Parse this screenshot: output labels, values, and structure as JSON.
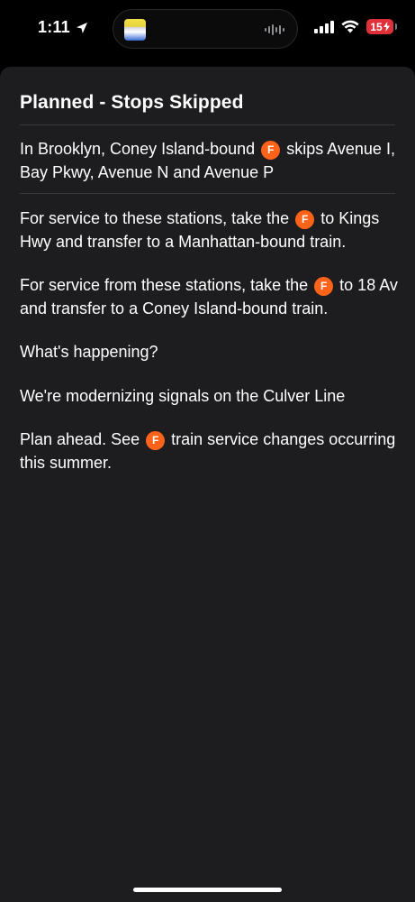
{
  "status_bar": {
    "time": "1:11",
    "battery": "15"
  },
  "alert": {
    "title": "Planned - Stops Skipped",
    "route_badge": "F",
    "summary": {
      "before": "In Brooklyn, Coney Island-bound",
      "after": "skips Avenue I, Bay Pkwy, Avenue N and Avenue P"
    },
    "to_service": {
      "before": "For service to these stations, take the",
      "after": "to Kings Hwy and transfer to a Manhattan-bound train."
    },
    "from_service": {
      "before": "For service from these stations, take the",
      "after": "to 18 Av and transfer to a Coney Island-bound train."
    },
    "whats_happening": "What's happening?",
    "reason": "We're modernizing signals on the Culver Line",
    "plan_ahead": {
      "before": "Plan ahead. See",
      "after": "train service changes occurring this summer."
    }
  },
  "colors": {
    "route_f": "#ff6319",
    "sheet_bg": "#1d1d1f",
    "battery_low": "#e0313b"
  }
}
